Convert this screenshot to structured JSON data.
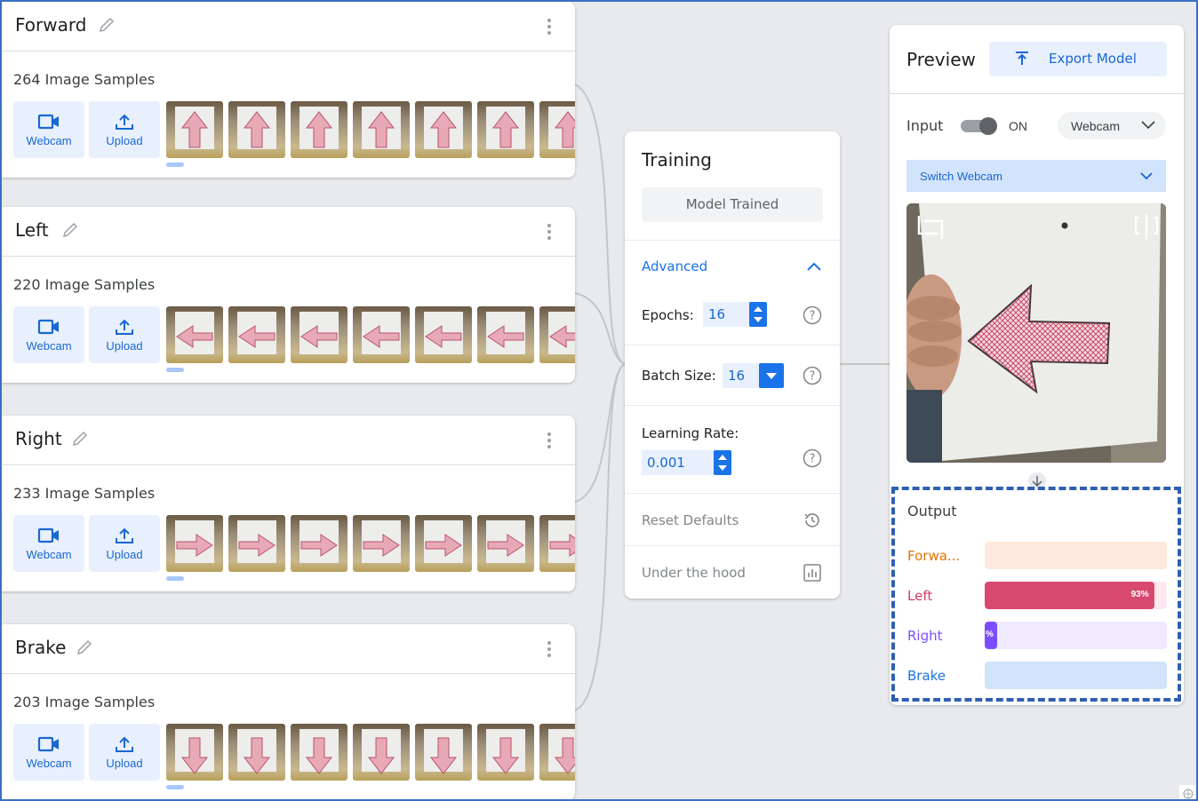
{
  "classes": [
    {
      "title": "Forward",
      "samples": "264 Image Samples",
      "webcam_label": "Webcam",
      "upload_label": "Upload"
    },
    {
      "title": "Left",
      "samples": "220 Image Samples",
      "webcam_label": "Webcam",
      "upload_label": "Upload"
    },
    {
      "title": "Right",
      "samples": "233 Image Samples",
      "webcam_label": "Webcam",
      "upload_label": "Upload"
    },
    {
      "title": "Brake",
      "samples": "203 Image Samples",
      "webcam_label": "Webcam",
      "upload_label": "Upload"
    }
  ],
  "training": {
    "title": "Training",
    "status_button": "Model Trained",
    "advanced_label": "Advanced",
    "epochs_label": "Epochs:",
    "epochs_value": "16",
    "batch_label": "Batch Size:",
    "batch_value": "16",
    "lr_label": "Learning Rate:",
    "lr_value": "0.001",
    "reset_label": "Reset Defaults",
    "hood_label": "Under the hood"
  },
  "preview": {
    "title": "Preview",
    "export_label": "Export Model",
    "input_label": "Input",
    "toggle_state": "ON",
    "source_value": "Webcam",
    "switch_webcam": "Switch Webcam"
  },
  "output": {
    "title": "Output",
    "rows": [
      {
        "label": "Forwa...",
        "color": "#e37400",
        "track": "#fde9dd",
        "fill": "#f28b54",
        "value": 0,
        "pct_text": ""
      },
      {
        "label": "Left",
        "color": "#d33b64",
        "track": "#fce8ee",
        "fill": "#d9486f",
        "value": 0.93,
        "pct_text": "93%"
      },
      {
        "label": "Right",
        "color": "#7c4dff",
        "track": "#efeaff",
        "fill": "#7c4dff",
        "value": 0.07,
        "pct_text": "%"
      },
      {
        "label": "Brake",
        "color": "#1a73e8",
        "track": "#d2e3fc",
        "fill": "#1a73e8",
        "value": 0,
        "pct_text": ""
      }
    ]
  },
  "colors": {
    "accent": "#1a73e8",
    "focus_border": "#2f5fb3"
  }
}
